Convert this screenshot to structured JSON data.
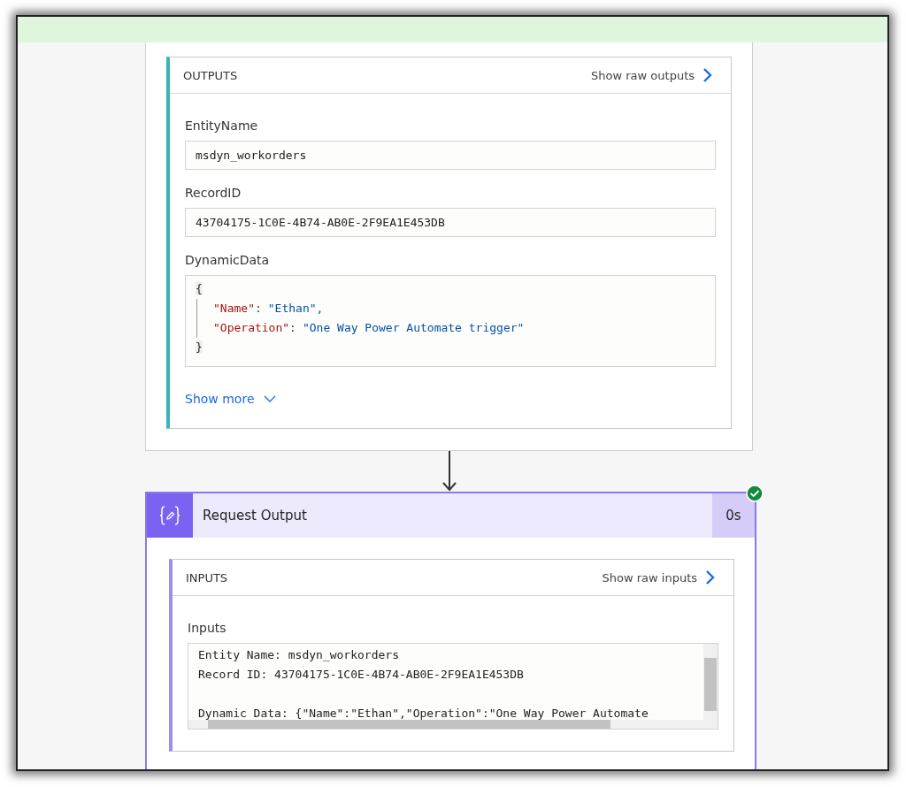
{
  "trigger_card": {
    "outputs": {
      "title": "OUTPUTS",
      "raw_link": "Show raw outputs",
      "fields": [
        {
          "kind": "text",
          "label": "EntityName",
          "value": "msdyn_workorders"
        },
        {
          "kind": "text",
          "label": "RecordID",
          "value": "43704175-1C0E-4B74-AB0E-2F9EA1E453DB"
        },
        {
          "kind": "json",
          "label": "DynamicData",
          "open": "{",
          "close": "}",
          "entries": [
            {
              "key": "\"Name\"",
              "sep": ":",
              "value": "\"Ethan\","
            },
            {
              "key": "\"Operation\"",
              "sep": ":",
              "value": "\"One Way Power Automate trigger\""
            }
          ]
        }
      ],
      "show_more": "Show more"
    }
  },
  "action_card": {
    "title": "Request Output",
    "duration": "0s",
    "succeeded": true,
    "inputs": {
      "title": "INPUTS",
      "raw_link": "Show raw inputs",
      "fields": [
        {
          "kind": "textarea",
          "label": "Inputs",
          "paragraphs": [
            [
              "Entity Name: msdyn_workorders",
              "Record ID: 43704175-1C0E-4B74-AB0E-2F9EA1E453DB"
            ],
            [
              "Dynamic Data: {\"Name\":\"Ethan\",\"Operation\":\"One Way Power Automate"
            ]
          ]
        }
      ]
    }
  }
}
